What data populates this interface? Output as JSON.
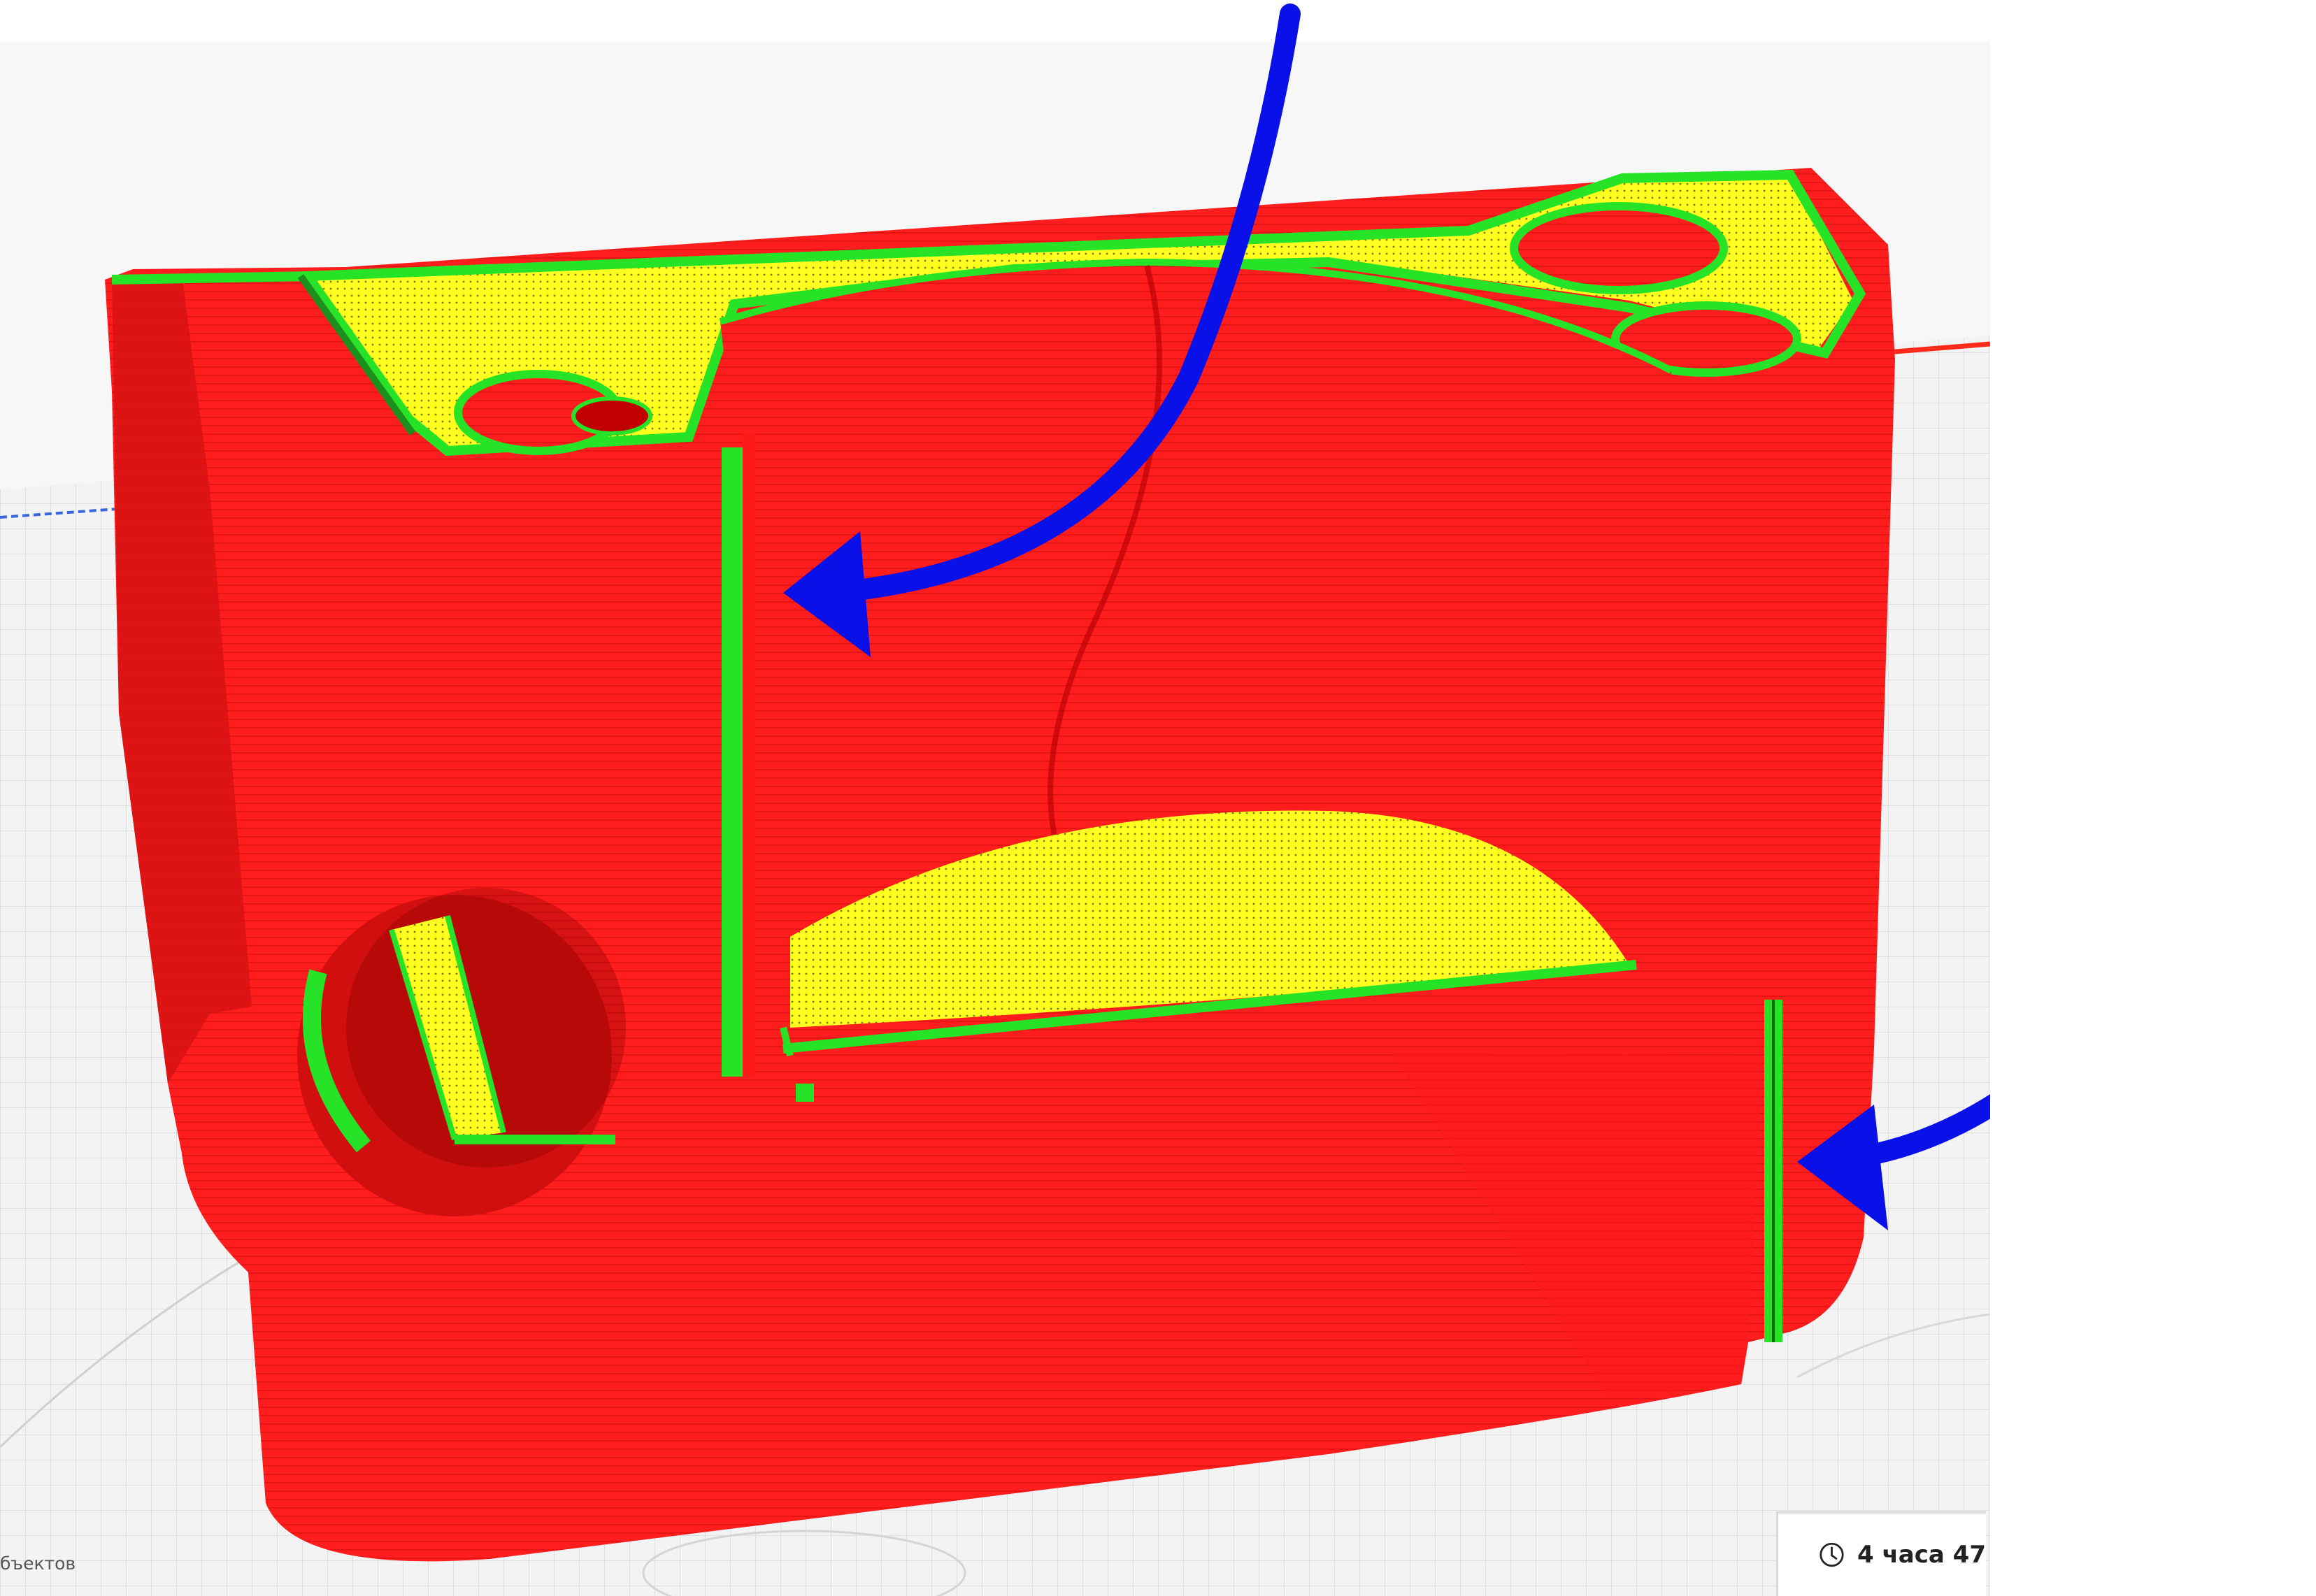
{
  "viewport": {
    "plate_color": "#eeeeee",
    "grid_color": "#cfcfcf",
    "x_axis_color": "#ff2a1a",
    "y_axis_color": "#3b66e0"
  },
  "model": {
    "colors": {
      "outer_wall": "#ff1a1a",
      "inner_wall": "#27e327",
      "top_bottom_skin": "#ffff1a"
    },
    "features": [
      "body-red",
      "skin-yellow",
      "wall-green",
      "front-hole-icon",
      "back-bore"
    ]
  },
  "annotations": {
    "arrow_color": "#0a10e8",
    "arrows": [
      "seam-arrow-top",
      "seam-arrow-right"
    ]
  },
  "status_bar": {
    "objects_label": "бъектов"
  },
  "print_estimate": {
    "icon": "clock-icon",
    "time_text": "4 часа 47"
  }
}
